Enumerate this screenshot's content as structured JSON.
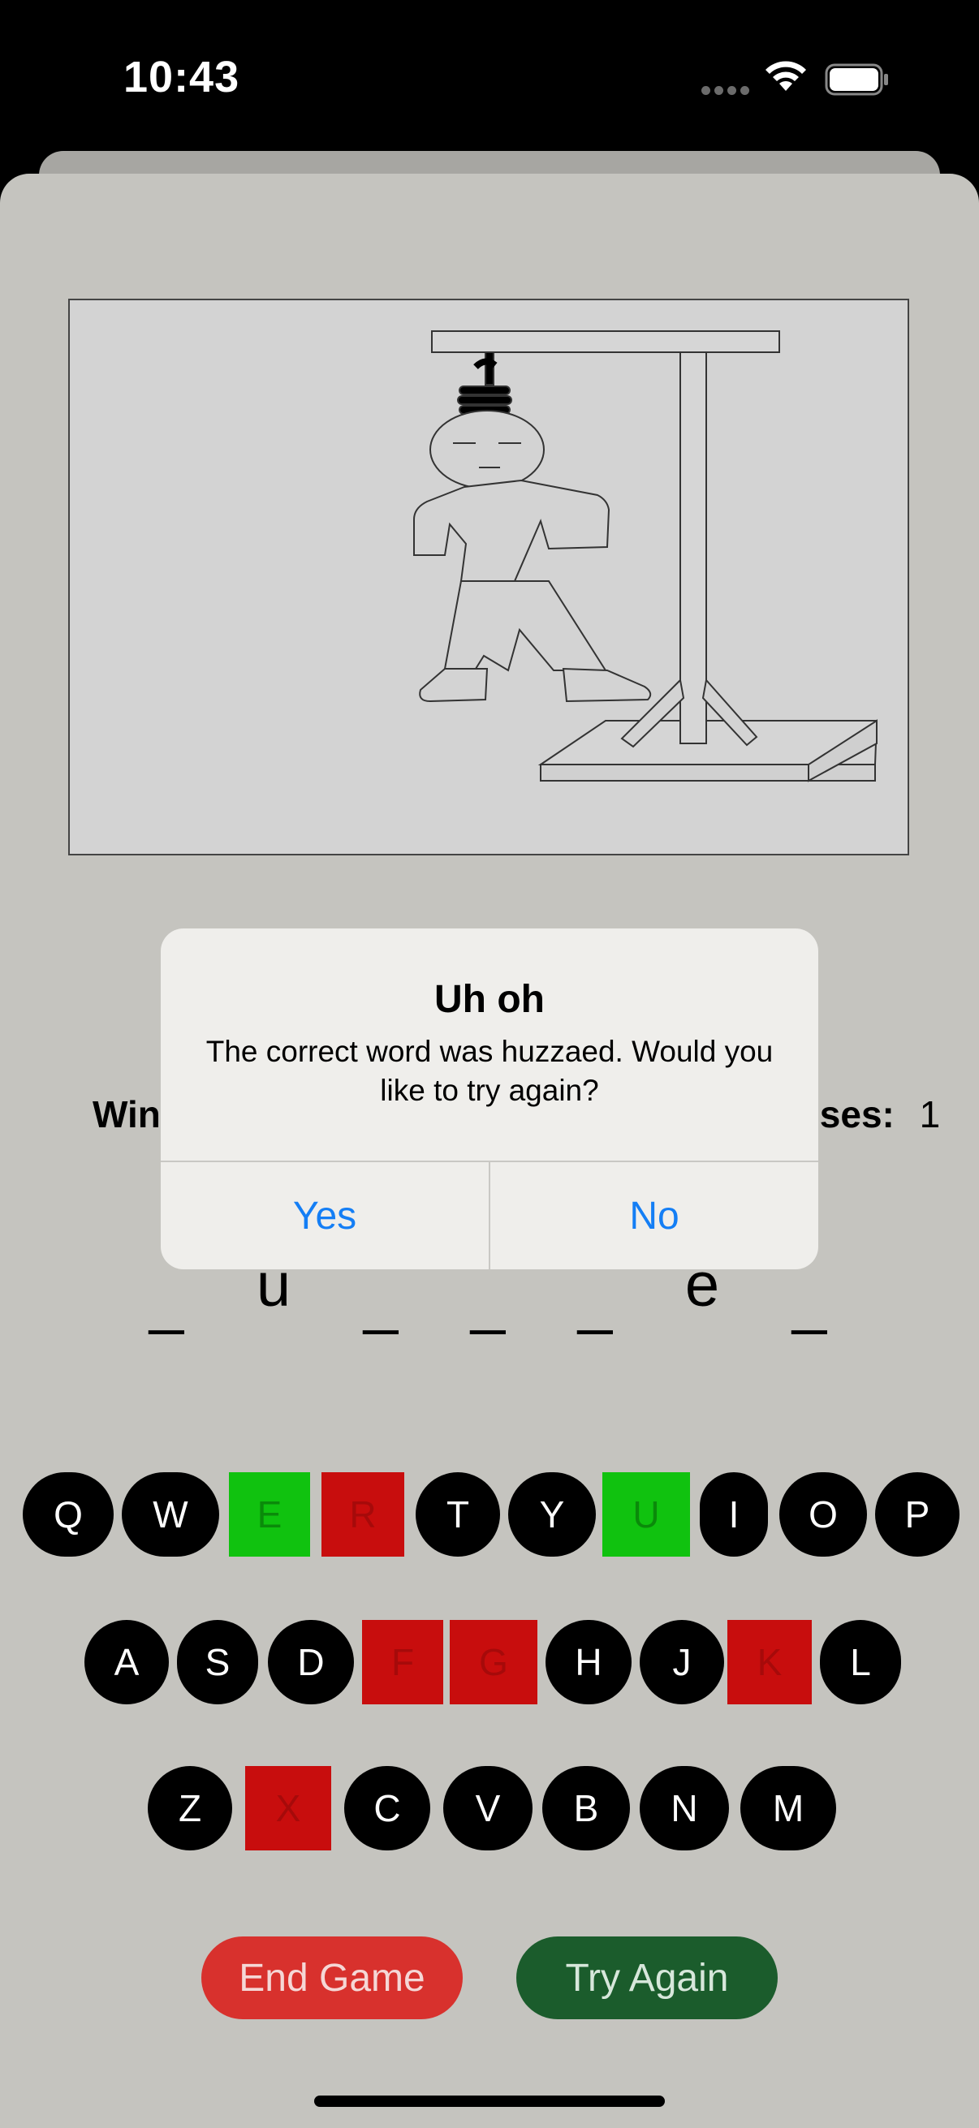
{
  "status": {
    "time": "10:43"
  },
  "game": {
    "wins_label": "Wins:",
    "losses_label": "Losses:",
    "losses_value": "1",
    "word_slots": [
      "_",
      "u",
      "_",
      "_",
      "_",
      "e",
      "_"
    ]
  },
  "keyboard": {
    "rows": [
      [
        "Q",
        "W",
        "E",
        "R",
        "T",
        "Y",
        "U",
        "I",
        "O",
        "P"
      ],
      [
        "A",
        "S",
        "D",
        "F",
        "G",
        "H",
        "J",
        "K",
        "L"
      ],
      [
        "Z",
        "X",
        "C",
        "V",
        "B",
        "N",
        "M"
      ]
    ],
    "correct": [
      "E",
      "U"
    ],
    "wrong": [
      "R",
      "F",
      "G",
      "K",
      "X"
    ]
  },
  "buttons": {
    "end_game": "End Game",
    "try_again": "Try Again"
  },
  "alert": {
    "title": "Uh oh",
    "message": "The correct word was huzzaed. Would you like to try again?",
    "yes": "Yes",
    "no": "No"
  },
  "colors": {
    "correct": "#10c20f",
    "wrong": "#c80d0d",
    "alert_button": "#147ef5",
    "end_game": "#d8312d",
    "try_again": "#1b5c2c"
  },
  "icons": [
    "wifi-icon",
    "battery-icon",
    "cellular-dots-icon"
  ]
}
